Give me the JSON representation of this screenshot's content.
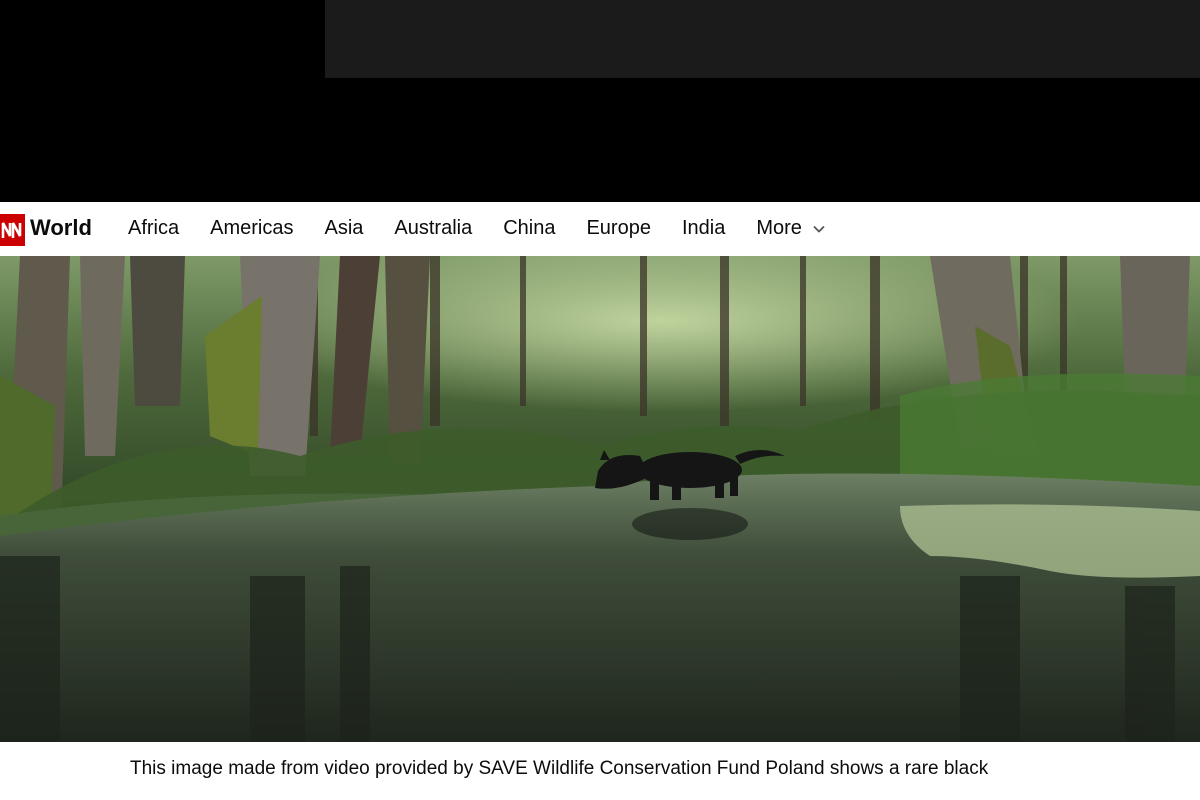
{
  "header": {
    "section_title": "World",
    "nav_items": [
      {
        "label": "Africa"
      },
      {
        "label": "Americas"
      },
      {
        "label": "Asia"
      },
      {
        "label": "Australia"
      },
      {
        "label": "China"
      },
      {
        "label": "Europe"
      },
      {
        "label": "India"
      }
    ],
    "more_label": "More",
    "brand_color": "#cc0000"
  },
  "photo": {
    "subject": "black wolf wading through forest stream"
  },
  "caption": {
    "text": "This image made from video provided by SAVE Wildlife Conservation Fund Poland shows a rare black"
  }
}
